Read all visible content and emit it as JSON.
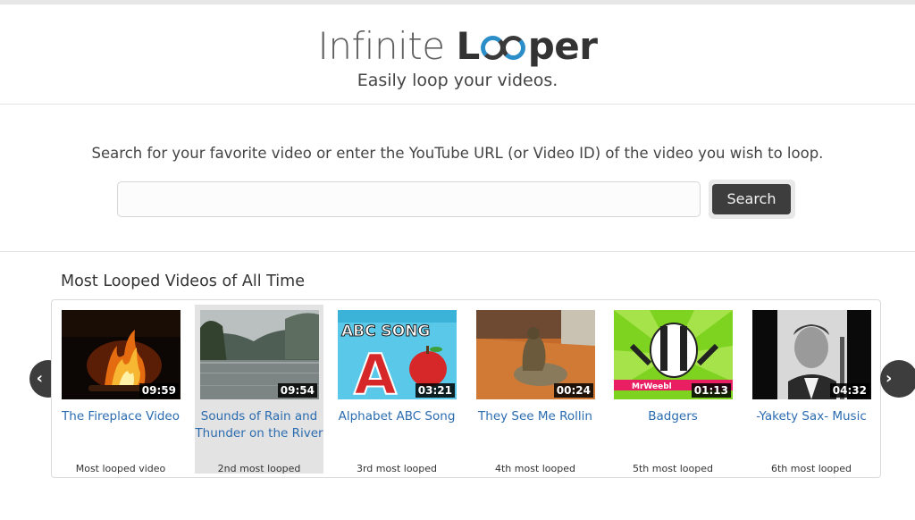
{
  "brand": {
    "logo_part1": "Infinite",
    "logo_part2_l": "L",
    "logo_part2_rest": "per",
    "tagline": "Easily loop your videos."
  },
  "search": {
    "prompt": "Search for your favorite video or enter the YouTube URL (or Video ID) of the video you wish to loop.",
    "placeholder": "",
    "value": "",
    "button_label": "Search"
  },
  "section_title": "Most Looped Videos of All Time",
  "videos": [
    {
      "title": "The Fireplace Video",
      "duration": "09:59",
      "rank": "Most looped video",
      "thumb": "fireplace"
    },
    {
      "title": "Sounds of Rain and Thunder on the River",
      "duration": "09:54",
      "rank": "2nd most looped",
      "thumb": "rain-river"
    },
    {
      "title": "Alphabet ABC Song",
      "duration": "03:21",
      "rank": "3rd most looped",
      "thumb": "abc-song",
      "thumb_text": "ABC SONG",
      "thumb_letter": "A"
    },
    {
      "title": "They See Me Rollin",
      "duration": "00:24",
      "rank": "4th most looped",
      "thumb": "tortoise"
    },
    {
      "title": "Badgers",
      "duration": "01:13",
      "rank": "5th most looped",
      "thumb": "badger",
      "thumb_text": "MrWeebl"
    },
    {
      "title": "-Yakety Sax- Music",
      "duration": "04:32",
      "rank": "6th most looped",
      "thumb": "saxophonist"
    }
  ],
  "nav": {
    "prev_icon": "chevron-left-icon",
    "next_icon": "chevron-right-icon"
  },
  "colors": {
    "link": "#2b6cb0",
    "accent": "#2b8ec9",
    "button": "#3d3d3d"
  }
}
